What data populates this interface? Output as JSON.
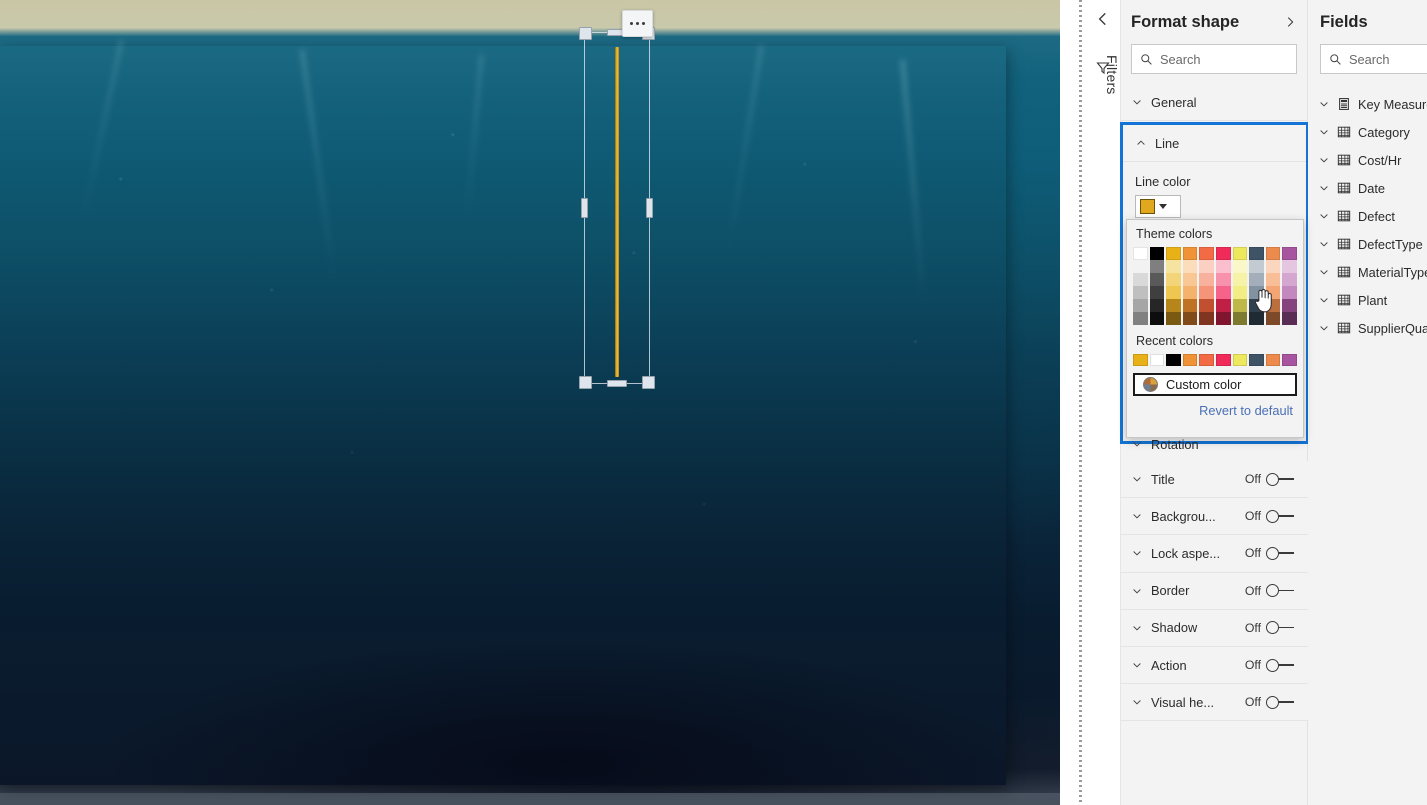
{
  "canvas": {
    "name": "report-canvas",
    "background_description": "underwater ocean photograph",
    "shape": {
      "name": "vertical-line-shape",
      "line_color": "#E0A81F",
      "selected": true
    },
    "context_menu_label": "More options"
  },
  "filters_rail": {
    "collapse_icon": "chevron-left-icon",
    "filter_icon": "filter-icon",
    "label": "Filters"
  },
  "format_pane": {
    "title": "Format shape",
    "expand_icon": "chevron-right-icon",
    "search": {
      "placeholder": "Search",
      "icon": "search-icon"
    },
    "sections": [
      {
        "label": "General",
        "state": "collapsed",
        "chevron": "chevron-down-icon"
      }
    ],
    "line_section": {
      "label": "Line",
      "chevron": "chevron-up-icon",
      "line_color_label": "Line color",
      "line_color_value": "#E0A81F"
    },
    "rotation_label": "Rotation",
    "toggle_rows": [
      {
        "label": "Title",
        "state": "Off"
      },
      {
        "label": "Backgrou...",
        "state": "Off"
      },
      {
        "label": "Lock aspe...",
        "state": "Off"
      },
      {
        "label": "Border",
        "state": "Off"
      },
      {
        "label": "Shadow",
        "state": "Off"
      },
      {
        "label": "Action",
        "state": "Off"
      },
      {
        "label": "Visual he...",
        "state": "Off"
      }
    ],
    "accent_color": "#1374D6"
  },
  "color_dropdown": {
    "theme_colors_label": "Theme colors",
    "recent_colors_label": "Recent colors",
    "custom_color_label": "Custom color",
    "custom_color_icon": "color-wheel-icon",
    "revert_label": "Revert to default",
    "theme_columns": [
      {
        "base": "#FFFFFF",
        "shades": [
          "#F2F2F2",
          "#D9D9D9",
          "#BFBFBF",
          "#A6A6A6",
          "#808080"
        ]
      },
      {
        "base": "#000000",
        "shades": [
          "#7F7F7F",
          "#595959",
          "#3F3F3F",
          "#262626",
          "#0D0D0D"
        ]
      },
      {
        "base": "#E8B117",
        "shades": [
          "#F7E3A0",
          "#F3D478",
          "#EFC64F",
          "#B7861A",
          "#7A5A11"
        ]
      },
      {
        "base": "#F09236",
        "shades": [
          "#FBDCBB",
          "#F8C794",
          "#F5B26C",
          "#C07224",
          "#804B18"
        ]
      },
      {
        "base": "#F26B44",
        "shades": [
          "#FBCFC2",
          "#F8B19D",
          "#F59478",
          "#C05030",
          "#803520"
        ]
      },
      {
        "base": "#F02B5A",
        "shades": [
          "#FBBECC",
          "#F891AB",
          "#F5638A",
          "#C01F46",
          "#80152F"
        ]
      },
      {
        "base": "#EEE85C",
        "shades": [
          "#FAF7C9",
          "#F6F2A7",
          "#F2ED84",
          "#BDB847",
          "#7E7A2F"
        ]
      },
      {
        "base": "#3E5366",
        "shades": [
          "#C3CAD2",
          "#A3AEBA",
          "#8292A1",
          "#2F3F4D",
          "#1F2A33"
        ]
      },
      {
        "base": "#ED8B4E",
        "shades": [
          "#FAD6BE",
          "#F7BE98",
          "#F3A573",
          "#BC6F3E",
          "#7D4A29"
        ]
      },
      {
        "base": "#A6559E",
        "shades": [
          "#E4C6E1",
          "#D4A7D0",
          "#C389BE",
          "#85447E",
          "#592D54"
        ]
      }
    ],
    "recent_colors": [
      "#E8B117",
      "#FFFFFF",
      "#000000",
      "#F09236",
      "#F26B44",
      "#F02B5A",
      "#EEE85C",
      "#3E5366",
      "#ED8B4E",
      "#A6559E"
    ]
  },
  "fields_pane": {
    "title": "Fields",
    "search": {
      "placeholder": "Search",
      "icon": "search-icon"
    },
    "items": [
      {
        "label": "Key Measure",
        "icon": "measure-icon"
      },
      {
        "label": "Category",
        "icon": "table-icon"
      },
      {
        "label": "Cost/Hr",
        "icon": "table-icon"
      },
      {
        "label": "Date",
        "icon": "table-icon"
      },
      {
        "label": "Defect",
        "icon": "table-icon"
      },
      {
        "label": "DefectType",
        "icon": "table-icon"
      },
      {
        "label": "MaterialType",
        "icon": "table-icon"
      },
      {
        "label": "Plant",
        "icon": "table-icon"
      },
      {
        "label": "SupplierQual",
        "icon": "table-icon"
      }
    ]
  }
}
